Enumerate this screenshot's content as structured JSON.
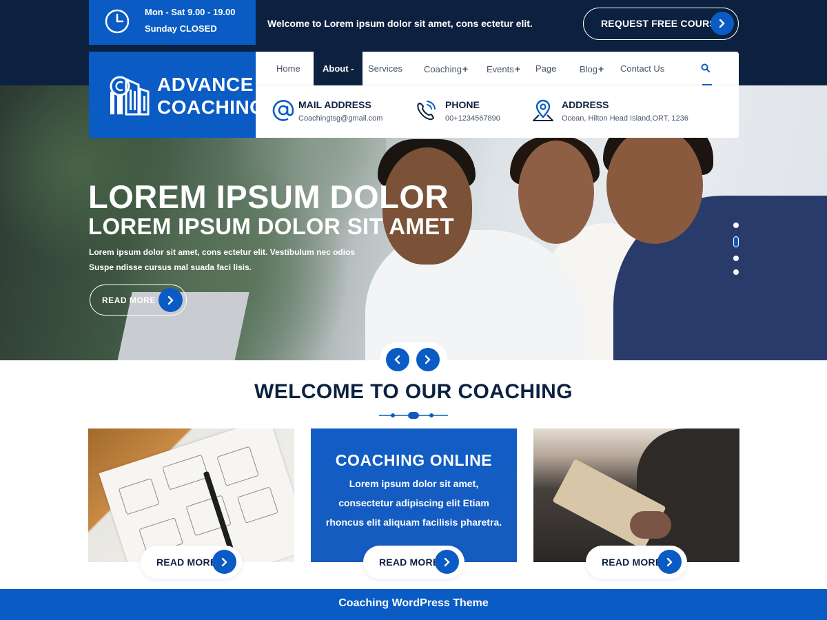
{
  "topbar": {
    "hours_line1": "Mon - Sat 9.00 - 19.00",
    "hours_line2": "Sunday CLOSED",
    "welcome": "Welcome to Lorem ipsum dolor sit amet, cons ectetur elit.",
    "request_button": "REQUEST FREE COURSE"
  },
  "logo": {
    "line1": "ADVANCE",
    "line2": "COACHING"
  },
  "nav": {
    "items": [
      {
        "label": "Home"
      },
      {
        "label": "About",
        "suffix": "-"
      },
      {
        "label": "Services"
      },
      {
        "label": "Coaching",
        "suffix": "+"
      },
      {
        "label": "Events",
        "suffix": "+"
      },
      {
        "label": "Page"
      },
      {
        "label": "Blog",
        "suffix": "+"
      },
      {
        "label": "Contact Us"
      }
    ],
    "active": "About"
  },
  "contact": {
    "mail_title": "MAIL ADDRESS",
    "mail_value": "Coachingtsg@gmail.com",
    "phone_title": "PHONE",
    "phone_value": "00+1234567890",
    "address_title": "ADDRESS",
    "address_value": "Ocean, Hilton Head Island,ORT, 1236"
  },
  "hero": {
    "title1": "LOREM IPSUM DOLOR",
    "title2": "LOREM IPSUM DOLOR SIT AMET",
    "description": "Lorem ipsum dolor sit amet, cons ectetur elit. Vestibulum nec odios Suspe ndisse cursus mal suada faci lisis.",
    "read_more": "READ MORE",
    "slide_count": 4,
    "active_slide": 2
  },
  "welcome": {
    "title": "WELCOME TO OUR COACHING"
  },
  "cards": [
    {
      "read_more": "READ MORE"
    },
    {
      "title": "COACHING ONLINE",
      "text": "Lorem ipsum dolor sit amet, consectetur adipiscing elit Etiam rhoncus elit aliquam facilisis pharetra.",
      "read_more": "READ MORE"
    },
    {
      "read_more": "READ MORE"
    }
  ],
  "footer": {
    "text": "Coaching WordPress Theme"
  },
  "colors": {
    "primary_blue": "#0a5bc4",
    "navy": "#0c2140",
    "white": "#ffffff"
  },
  "icons": [
    "clock-icon",
    "chevron-right-icon",
    "chevron-left-icon",
    "logo-icon",
    "search-icon",
    "at-sign-icon",
    "phone-icon",
    "map-pin-icon"
  ]
}
